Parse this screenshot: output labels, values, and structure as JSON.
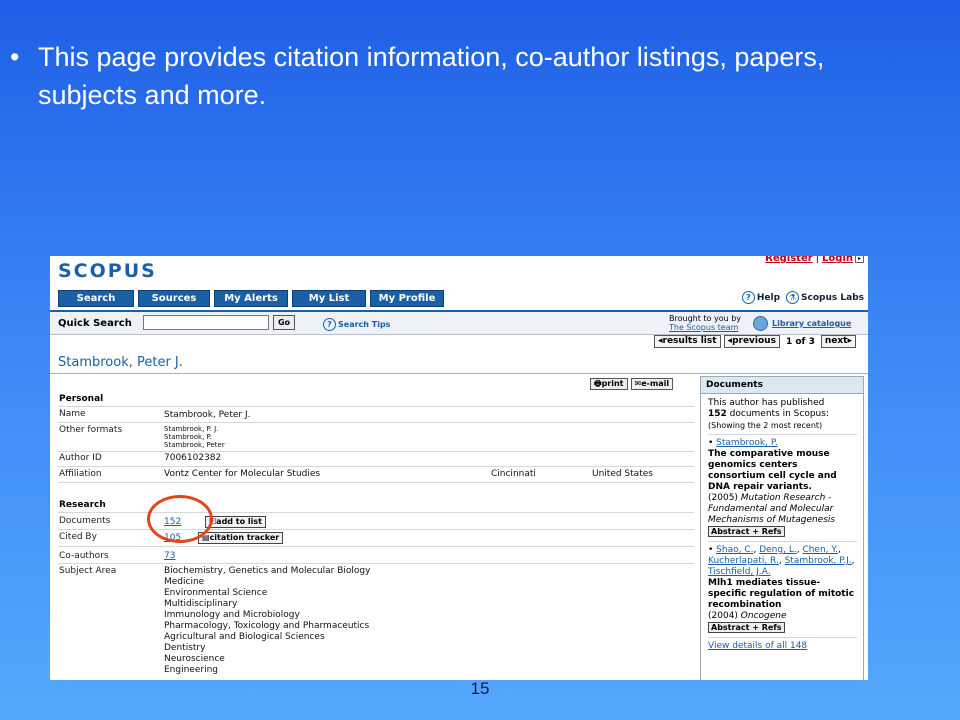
{
  "slide": {
    "bullet": "•",
    "text": "This page provides citation information, co-author listings, papers, subjects and more.",
    "page_number": "15"
  },
  "header": {
    "logo": "SCOPUS",
    "register": "Register",
    "separator": "|",
    "login": "Login"
  },
  "nav": {
    "tabs": [
      "Search",
      "Sources",
      "My Alerts",
      "My List",
      "My Profile"
    ],
    "help": "Help",
    "labs": "Scopus Labs"
  },
  "quick_search": {
    "label": "Quick Search",
    "value": "",
    "go": "Go",
    "tips": "Search Tips",
    "brought_line1": "Brought to you by",
    "brought_line2": "The Scopus team",
    "library": "Library catalogue"
  },
  "pager": {
    "results_list": "results list",
    "previous": "previous",
    "page": "1 of 3",
    "next": "next"
  },
  "author": {
    "name": "Stambrook, Peter J.",
    "print": "print",
    "email": "e-mail"
  },
  "personal": {
    "heading": "Personal",
    "name_label": "Name",
    "name_value": "Stambrook, Peter J.",
    "other_label": "Other formats",
    "other_values": [
      "Stambrook, P. J.",
      "Stambrook, P.",
      "Stambrook, Peter"
    ],
    "id_label": "Author ID",
    "id_value": "7006102382",
    "aff_label": "Affiliation",
    "aff_value": "Vontz Center for Molecular Studies",
    "aff_city": "Cincinnati",
    "aff_country": "United States"
  },
  "research": {
    "heading": "Research",
    "docs_label": "Documents",
    "docs_value": "152",
    "add_to_list": "add to list",
    "cited_label": "Cited By",
    "cited_value": "105",
    "citation_tracker": "citation tracker",
    "coauthors_label": "Co-authors",
    "coauthors_value": "73",
    "subject_label": "Subject Area",
    "subjects": [
      "Biochemistry, Genetics and Molecular Biology",
      "Medicine",
      "Environmental Science",
      "Multidisciplinary",
      "Immunology and Microbiology",
      "Pharmacology, Toxicology and Pharmaceutics",
      "Agricultural and Biological Sciences",
      "Dentistry",
      "Neuroscience",
      "Engineering"
    ]
  },
  "documents_panel": {
    "heading": "Documents",
    "intro1": "This author has published",
    "intro2a": "152",
    "intro2b": " documents in Scopus:",
    "intro3": "(Showing the 2 most recent)",
    "doc1_author": "Stambrook, P.",
    "doc1_title": "The comparative mouse genomics centers consortium cell cycle and DNA repair variants.",
    "doc1_year": "(2005) ",
    "doc1_source": "Mutation Research - Fundamental and Molecular Mechanisms of Mutagenesis",
    "abstract_refs": "Abstract + Refs",
    "doc2_authors": [
      "Shao, C.",
      "Deng, L.",
      "Chen, Y.",
      "Kucherlapati, R.",
      "Stambrook, P.J.",
      "Tischfield, J.A."
    ],
    "doc2_title": "Mlh1 mediates tissue-specific regulation of mitotic recombination",
    "doc2_year": "(2004) ",
    "doc2_source": "Oncogene",
    "view_all": "View details of all 148"
  },
  "colors": {
    "accent": "#1b5fa6",
    "slide_bg_top": "#1f5fe6",
    "slide_bg_bottom": "#55a8fb",
    "highlight_circle": "#e0451b",
    "register_link": "#c0001a"
  }
}
